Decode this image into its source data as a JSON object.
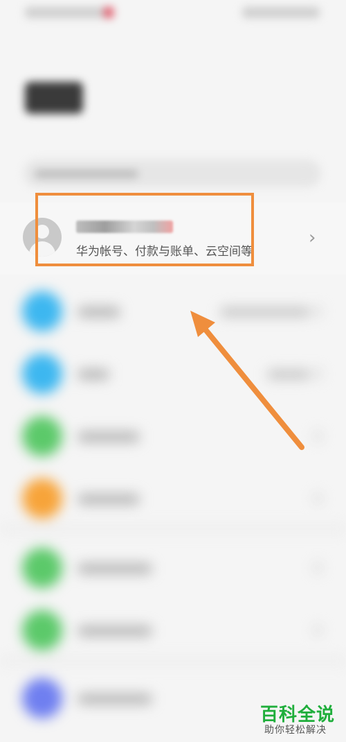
{
  "account": {
    "subtitle": "华为帐号、付款与账单、云空间等",
    "chevron": "›"
  },
  "icons": {
    "avatar": "person-silhouette-icon",
    "chevron": "chevron-right-icon"
  },
  "list_icon_colors": [
    "#3db7f0",
    "#3db7f0",
    "#5cc96a",
    "#f7a43a",
    "#5cc96a",
    "#5cc96a",
    "#6f7ff0"
  ],
  "colors": {
    "highlight": "#ef8e3d",
    "arrow": "#ef8e3d",
    "watermark_green": "#1fae3b"
  },
  "watermark": {
    "title": "百科全说",
    "subtitle": "助你轻松解决"
  }
}
